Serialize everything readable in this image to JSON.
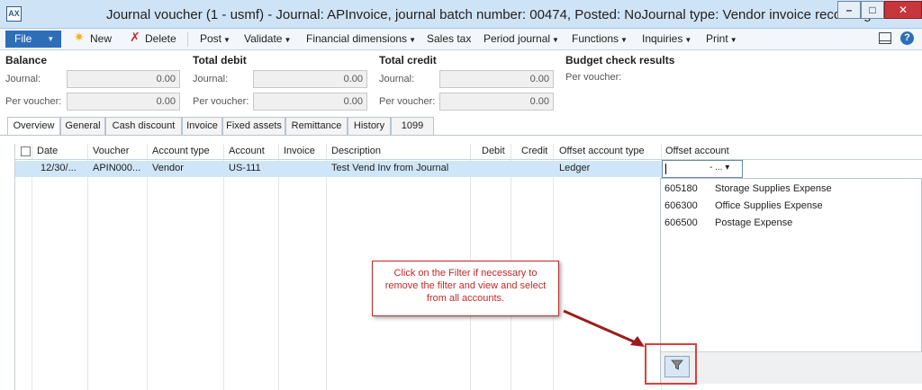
{
  "window": {
    "title": "Journal voucher (1 - usmf) - Journal: APInvoice, journal batch number: 00474, Posted: NoJournal type: Vendor invoice recording",
    "app_icon": "ax-icon",
    "min_label": "–",
    "max_label": "□",
    "close_label": "✕"
  },
  "toolbar": {
    "file_label": "File",
    "new_label": "New",
    "delete_label": "Delete",
    "post_label": "Post",
    "validate_label": "Validate",
    "financial_dimensions_label": "Financial dimensions",
    "sales_tax_label": "Sales tax",
    "period_journal_label": "Period journal",
    "functions_label": "Functions",
    "inquiries_label": "Inquiries",
    "print_label": "Print"
  },
  "summary": {
    "balance": {
      "title": "Balance",
      "journal_label": "Journal:",
      "journal_value": "0.00",
      "per_voucher_label": "Per voucher:",
      "per_voucher_value": "0.00"
    },
    "total_debit": {
      "title": "Total debit",
      "journal_label": "Journal:",
      "journal_value": "0.00",
      "per_voucher_label": "Per voucher:",
      "per_voucher_value": "0.00"
    },
    "total_credit": {
      "title": "Total credit",
      "journal_label": "Journal:",
      "journal_value": "0.00",
      "per_voucher_label": "Per voucher:",
      "per_voucher_value": "0.00"
    },
    "budget": {
      "title": "Budget check results",
      "per_voucher_label": "Per voucher:"
    }
  },
  "tabs": [
    "Overview",
    "General",
    "Cash discount",
    "Invoice",
    "Fixed assets",
    "Remittance",
    "History",
    "1099"
  ],
  "grid": {
    "columns": [
      "Date",
      "Voucher",
      "Account type",
      "Account",
      "Invoice",
      "Description",
      "Debit",
      "Credit",
      "Offset account type",
      "Offset account"
    ],
    "rows": [
      {
        "date": "12/30/...",
        "voucher": "APIN000...",
        "account_type": "Vendor",
        "account": "US-111",
        "invoice": "",
        "description": "Test Vend Inv from Journal",
        "debit": "",
        "credit": "",
        "offset_account_type": "Ledger",
        "offset_account": ""
      }
    ],
    "offset_input_dropdown": "- ... ▾"
  },
  "lookup": {
    "items": [
      {
        "code": "605180",
        "name": "Storage Supplies Expense"
      },
      {
        "code": "606300",
        "name": "Office Supplies Expense"
      },
      {
        "code": "606500",
        "name": "Postage Expense"
      }
    ],
    "filter_icon": "filter-icon"
  },
  "callout": {
    "text": "Click on the Filter if necessary to remove the filter and view and select from all accounts."
  },
  "colors": {
    "accent": "#2e6eb8",
    "callout_red": "#c62828",
    "selected_row": "#cfe6f8"
  }
}
